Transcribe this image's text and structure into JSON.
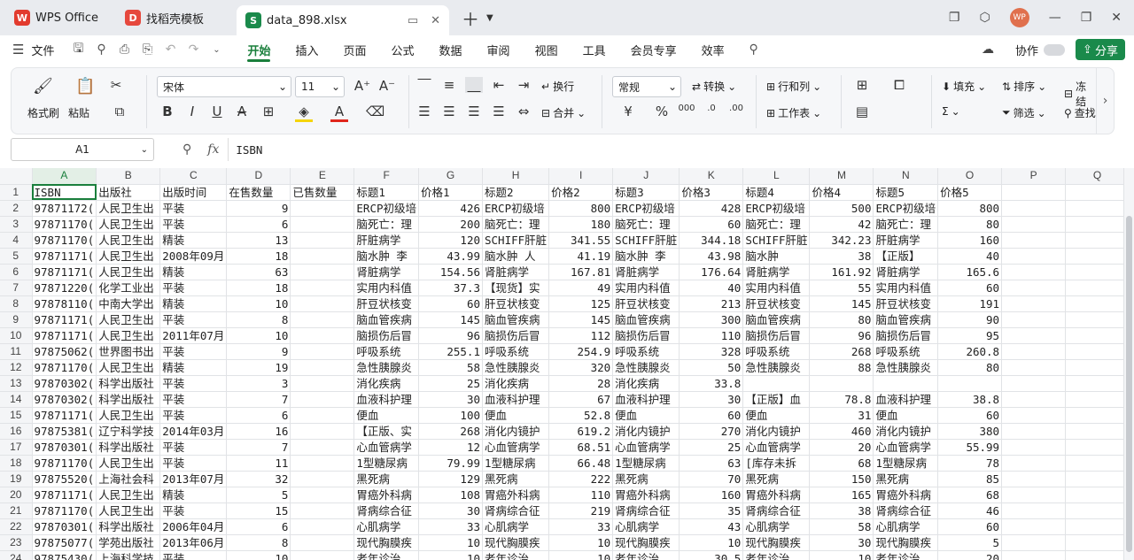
{
  "tabs": [
    {
      "label": "WPS Office",
      "logo": "W",
      "color": "#e23b2e"
    },
    {
      "label": "找稻壳模板",
      "logo": "D",
      "color": "#e6483d"
    },
    {
      "label": "data_898.xlsx",
      "logo": "S",
      "color": "#1a8a4b"
    }
  ],
  "menu": {
    "file": "文件",
    "items": [
      "开始",
      "插入",
      "页面",
      "公式",
      "数据",
      "审阅",
      "视图",
      "工具",
      "会员专享",
      "效率"
    ],
    "active": "开始",
    "collab": "协作",
    "share": "分享"
  },
  "ribbon": {
    "format_painter": "格式刷",
    "paste": "粘贴",
    "font_name": "宋体",
    "font_size": "11",
    "wrap": "换行",
    "merge": "合并",
    "number_format": "常规",
    "convert": "转换",
    "rows_cols": "行和列",
    "worksheet": "工作表",
    "fill": "填充",
    "sort": "排序",
    "freeze": "冻结",
    "filter": "筛选",
    "find": "查找"
  },
  "formula_bar": {
    "cell": "A1",
    "fx": "fx",
    "value": "ISBN"
  },
  "sheet": {
    "columns": [
      "A",
      "B",
      "C",
      "D",
      "E",
      "F",
      "G",
      "H",
      "I",
      "J",
      "K",
      "L",
      "M",
      "N",
      "O",
      "P",
      "Q"
    ],
    "rows": [
      [
        "ISBN",
        "出版社",
        "出版时间",
        "在售数量",
        "已售数量",
        "标题1",
        "价格1",
        "标题2",
        "价格2",
        "标题3",
        "价格3",
        "标题4",
        "价格4",
        "标题5",
        "价格5",
        "",
        ""
      ],
      [
        "97871172(",
        "人民卫生出",
        "平装",
        "9",
        "",
        "ERCP初级培",
        "426",
        "ERCP初级培",
        "800",
        "ERCP初级培",
        "428",
        "ERCP初级培",
        "500",
        "ERCP初级培",
        "800",
        "",
        ""
      ],
      [
        "97871170(",
        "人民卫生出",
        "平装",
        "6",
        "",
        "脑死亡：理",
        "200",
        "脑死亡：理",
        "180",
        "脑死亡：理",
        "60",
        "脑死亡：理",
        "42",
        "脑死亡：理",
        "80",
        "",
        ""
      ],
      [
        "97871170(",
        "人民卫生出",
        "精装",
        "13",
        "",
        "肝脏病学",
        "120",
        "SCHIFF肝脏",
        "341.55",
        "SCHIFF肝脏",
        "344.18",
        "SCHIFF肝脏",
        "342.23",
        "肝脏病学",
        "160",
        "",
        ""
      ],
      [
        "97871171(",
        "人民卫生出",
        "2008年09月",
        "18",
        "",
        "脑水肿 李",
        "43.99",
        "脑水肿 人",
        "41.19",
        "脑水肿 李",
        "43.98",
        "脑水肿",
        "38",
        "【正版】",
        "40",
        "",
        ""
      ],
      [
        "97871171(",
        "人民卫生出",
        "精装",
        "63",
        "",
        "肾脏病学",
        "154.56",
        "肾脏病学",
        "167.81",
        "肾脏病学",
        "176.64",
        "肾脏病学",
        "161.92",
        "肾脏病学",
        "165.6",
        "",
        ""
      ],
      [
        "97871220(",
        "化学工业出",
        "平装",
        "18",
        "",
        "实用内科值",
        "37.3",
        "【现货】实",
        "49",
        "实用内科值",
        "40",
        "实用内科值",
        "55",
        "实用内科值",
        "60",
        "",
        ""
      ],
      [
        "97878110(",
        "中南大学出",
        "精装",
        "10",
        "",
        "肝豆状核变",
        "60",
        "肝豆状核变",
        "125",
        "肝豆状核变",
        "213",
        "肝豆状核变",
        "145",
        "肝豆状核变",
        "191",
        "",
        ""
      ],
      [
        "97871171(",
        "人民卫生出",
        "平装",
        "8",
        "",
        "脑血管疾病",
        "145",
        "脑血管疾病",
        "145",
        "脑血管疾病",
        "300",
        "脑血管疾病",
        "80",
        "脑血管疾病",
        "90",
        "",
        ""
      ],
      [
        "97871171(",
        "人民卫生出",
        "2011年07月",
        "10",
        "",
        "脑损伤后冒",
        "96",
        "脑损伤后冒",
        "112",
        "脑损伤后冒",
        "110",
        "脑损伤后冒",
        "96",
        "脑损伤后冒",
        "95",
        "",
        ""
      ],
      [
        "97875062(",
        "世界图书出",
        "平装",
        "9",
        "",
        "呼吸系统",
        "255.1",
        "呼吸系统",
        "254.9",
        "呼吸系统",
        "328",
        "呼吸系统",
        "268",
        "呼吸系统",
        "260.8",
        "",
        ""
      ],
      [
        "97871170(",
        "人民卫生出",
        "精装",
        "19",
        "",
        "急性胰腺炎",
        "58",
        "急性胰腺炎",
        "320",
        "急性胰腺炎",
        "50",
        "急性胰腺炎",
        "88",
        "急性胰腺炎",
        "80",
        "",
        ""
      ],
      [
        "97870302(",
        "科学出版社",
        "平装",
        "3",
        "",
        "消化疾病",
        "25",
        "消化疾病",
        "28",
        "消化疾病",
        "33.8",
        "",
        "",
        "",
        "",
        "",
        ""
      ],
      [
        "97870302(",
        "科学出版社",
        "平装",
        "7",
        "",
        "血液科护理",
        "30",
        "血液科护理",
        "67",
        "血液科护理",
        "30",
        "【正版】血",
        "78.8",
        "血液科护理",
        "38.8",
        "",
        ""
      ],
      [
        "97871171(",
        "人民卫生出",
        "平装",
        "6",
        "",
        "便血",
        "100",
        "便血",
        "52.8",
        "便血",
        "60",
        "便血",
        "31",
        "便血",
        "60",
        "",
        ""
      ],
      [
        "97875381(",
        "辽宁科学技",
        "2014年03月",
        "16",
        "",
        "【正版、实",
        "268",
        "消化内镜护",
        "619.2",
        "消化内镜护",
        "270",
        "消化内镜护",
        "460",
        "消化内镜护",
        "380",
        "",
        ""
      ],
      [
        "97870301(",
        "科学出版社",
        "平装",
        "7",
        "",
        "心血管病学",
        "12",
        "心血管病学",
        "68.51",
        "心血管病学",
        "25",
        "心血管病学",
        "20",
        "心血管病学",
        "55.99",
        "",
        ""
      ],
      [
        "97871170(",
        "人民卫生出",
        "平装",
        "11",
        "",
        "1型糖尿病",
        "79.99",
        "1型糖尿病",
        "66.48",
        "1型糖尿病",
        "63",
        "[库存未拆",
        "68",
        "1型糖尿病",
        "78",
        "",
        ""
      ],
      [
        "97875520(",
        "上海社会科",
        "2013年07月",
        "32",
        "",
        "黑死病",
        "129",
        "黑死病",
        "222",
        "黑死病",
        "70",
        "黑死病",
        "150",
        "黑死病",
        "85",
        "",
        ""
      ],
      [
        "97871171(",
        "人民卫生出",
        "精装",
        "5",
        "",
        "胃癌外科病",
        "108",
        "胃癌外科病",
        "110",
        "胃癌外科病",
        "160",
        "胃癌外科病",
        "165",
        "胃癌外科病",
        "68",
        "",
        ""
      ],
      [
        "97871170(",
        "人民卫生出",
        "平装",
        "15",
        "",
        "肾病综合征",
        "30",
        "肾病综合征",
        "219",
        "肾病综合征",
        "35",
        "肾病综合征",
        "38",
        "肾病综合征",
        "46",
        "",
        ""
      ],
      [
        "97870301(",
        "科学出版社",
        "2006年04月",
        "6",
        "",
        "心肌病学",
        "33",
        "心肌病学",
        "33",
        "心肌病学",
        "43",
        "心肌病学",
        "58",
        "心肌病学",
        "60",
        "",
        ""
      ],
      [
        "97875077(",
        "学苑出版社",
        "2013年06月",
        "8",
        "",
        "现代胸膜疾",
        "10",
        "现代胸膜疾",
        "10",
        "现代胸膜疾",
        "10",
        "现代胸膜疾",
        "30",
        "现代胸膜疾",
        "5",
        "",
        ""
      ],
      [
        "97875430(",
        "上海科学技",
        "平装",
        "10",
        "",
        "老年诊治",
        "10",
        "老年诊治",
        "10",
        "老年诊治",
        "30.5",
        "老年诊治",
        "10",
        "老年诊治",
        "20",
        "",
        ""
      ]
    ]
  }
}
